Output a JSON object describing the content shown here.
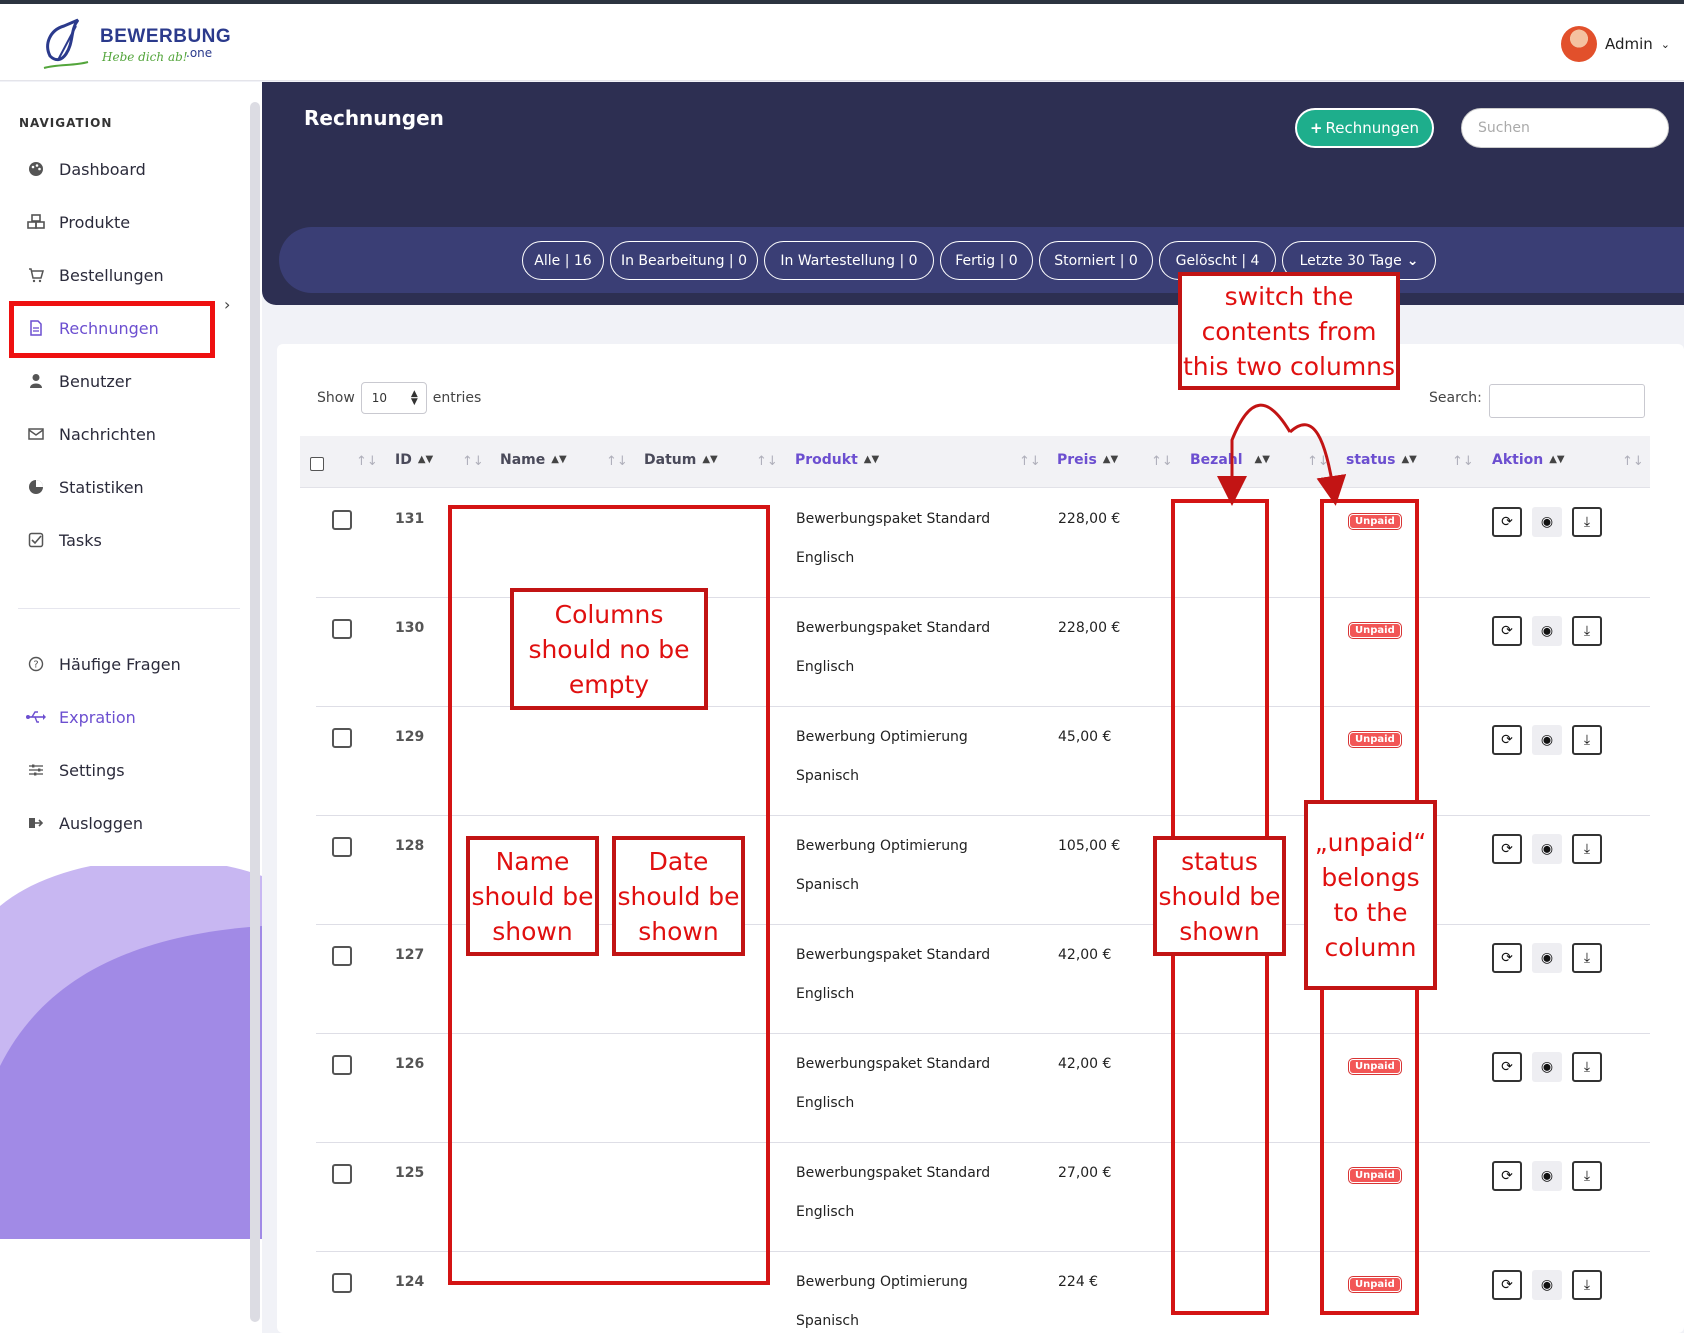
{
  "header": {
    "logo_title": "BEWERBUNG",
    "logo_tld": ".one",
    "logo_slogan": "Hebe dich ab!",
    "user_name": "Admin"
  },
  "sidebar": {
    "heading": "NAVIGATION",
    "items": [
      {
        "label": "Dashboard",
        "icon": "palette-icon"
      },
      {
        "label": "Produkte",
        "icon": "cubes-icon"
      },
      {
        "label": "Bestellungen",
        "icon": "cart-icon"
      },
      {
        "label": "Rechnungen",
        "icon": "invoice-icon"
      },
      {
        "label": "Benutzer",
        "icon": "user-icon"
      },
      {
        "label": "Nachrichten",
        "icon": "mail-icon"
      },
      {
        "label": "Statistiken",
        "icon": "pie-icon"
      },
      {
        "label": "Tasks",
        "icon": "checkbox-icon"
      }
    ],
    "items2": [
      {
        "label": "Häufige Fragen",
        "icon": "question-icon"
      },
      {
        "label": "Expration",
        "icon": "usb-icon"
      },
      {
        "label": "Settings",
        "icon": "sliders-icon"
      },
      {
        "label": "Ausloggen",
        "icon": "logout-icon"
      }
    ]
  },
  "page": {
    "title": "Rechnungen",
    "add_button": "Rechnungen",
    "search_placeholder": "Suchen",
    "filters": [
      "Alle | 16",
      "In Bearbeitung | 0",
      "In Wartestellung | 0",
      "Fertig | 0",
      "Storniert | 0",
      "Gelöscht | 4",
      "Letzte 30 Tage"
    ]
  },
  "table_controls": {
    "show": "Show",
    "entries_value": "10",
    "entries": "entries",
    "search_label": "Search:"
  },
  "table": {
    "headers": {
      "id": "ID",
      "name": "Name",
      "datum": "Datum",
      "produkt": "Produkt",
      "preis": "Preis",
      "bezahlt": "Bezahl",
      "status": "status",
      "aktion": "Aktion"
    },
    "rows": [
      {
        "id": "131",
        "product": "Bewerbungspaket Standard",
        "language": "Englisch",
        "price": "228,00 €",
        "status": "Unpaid"
      },
      {
        "id": "130",
        "product": "Bewerbungspaket Standard",
        "language": "Englisch",
        "price": "228,00 €",
        "status": "Unpaid"
      },
      {
        "id": "129",
        "product": "Bewerbung Optimierung",
        "language": "Spanisch",
        "price": "45,00 €",
        "status": "Unpaid"
      },
      {
        "id": "128",
        "product": "Bewerbung Optimierung",
        "language": "Spanisch",
        "price": "105,00 €",
        "status": ""
      },
      {
        "id": "127",
        "product": "Bewerbungspaket Standard",
        "language": "Englisch",
        "price": "42,00 €",
        "status": ""
      },
      {
        "id": "126",
        "product": "Bewerbungspaket Standard",
        "language": "Englisch",
        "price": "42,00 €",
        "status": "Unpaid"
      },
      {
        "id": "125",
        "product": "Bewerbungspaket Standard",
        "language": "Englisch",
        "price": "27,00 €",
        "status": "Unpaid"
      },
      {
        "id": "124",
        "product": "Bewerbung Optimierung",
        "language": "Spanisch",
        "price": "224 €",
        "status": "Unpaid"
      }
    ]
  },
  "annotations": {
    "switch": "switch the contents from this two columns",
    "empty": "Columns should no be empty",
    "name": "Name should be shown",
    "date": "Date should be shown",
    "status": "status should be shown",
    "unpaid": "„unpaid“ belongs to the column"
  },
  "colors": {
    "accent": "#6c4fd0",
    "hero": "#2d2f52",
    "filter_bar": "#3a3e75",
    "add_button": "#1eae8c",
    "annotation_red": "#d41414",
    "badge": "#f25656"
  }
}
